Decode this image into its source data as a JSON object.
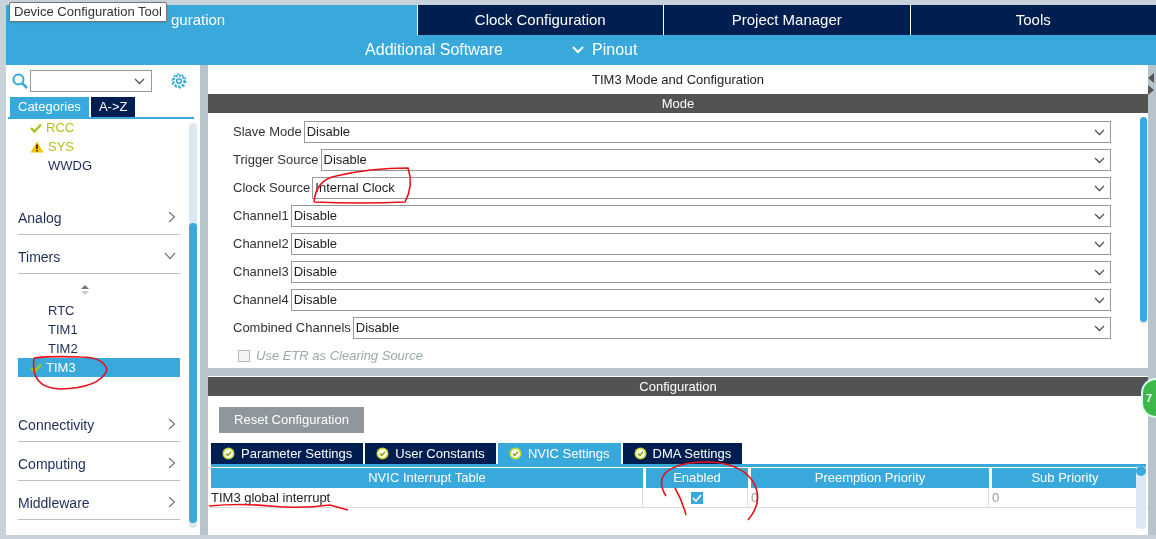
{
  "tooltip": {
    "text": "Device Configuration Tool"
  },
  "top_tabs": [
    {
      "label": "guration",
      "selected": true
    },
    {
      "label": "Clock Configuration",
      "selected": false
    },
    {
      "label": "Project Manager",
      "selected": false
    },
    {
      "label": "Tools",
      "selected": false
    }
  ],
  "sub_tabs": [
    {
      "label": "Additional Software",
      "kind": "link"
    },
    {
      "label": "Pinout",
      "kind": "dropdown"
    }
  ],
  "sidebar": {
    "view_tabs": [
      {
        "label": "Categories",
        "selected": true
      },
      {
        "label": "A->Z",
        "selected": false
      }
    ],
    "peripherals": [
      {
        "label": "RCC",
        "configured": true,
        "warning": false,
        "selected": false
      },
      {
        "label": "SYS",
        "configured": false,
        "warning": true,
        "selected": false
      },
      {
        "label": "WWDG",
        "configured": false,
        "warning": false,
        "selected": false
      }
    ],
    "categories": [
      {
        "label": "Analog",
        "expanded": false
      },
      {
        "label": "Timers",
        "expanded": true,
        "children": [
          {
            "label": "RTC",
            "configured": false,
            "warning": false,
            "selected": false
          },
          {
            "label": "TIM1",
            "configured": false,
            "warning": false,
            "selected": false
          },
          {
            "label": "TIM2",
            "configured": false,
            "warning": false,
            "selected": false
          },
          {
            "label": "TIM3",
            "configured": true,
            "warning": false,
            "selected": true
          }
        ]
      },
      {
        "label": "Connectivity",
        "expanded": false
      },
      {
        "label": "Computing",
        "expanded": false
      },
      {
        "label": "Middleware",
        "expanded": false
      }
    ]
  },
  "mode_panel": {
    "title": "TIM3 Mode and Configuration",
    "header": "Mode",
    "fields": [
      {
        "label": "Slave Mode",
        "value": "Disable"
      },
      {
        "label": "Trigger Source",
        "value": "Disable"
      },
      {
        "label": "Clock Source",
        "value": "Internal Clock"
      },
      {
        "label": "Channel1",
        "value": "Disable"
      },
      {
        "label": "Channel2",
        "value": "Disable"
      },
      {
        "label": "Channel3",
        "value": "Disable"
      },
      {
        "label": "Channel4",
        "value": "Disable"
      },
      {
        "label": "Combined Channels",
        "value": "Disable"
      }
    ],
    "option": {
      "label": "Use ETR as Clearing Source",
      "checked": false,
      "disabled": true
    }
  },
  "config_panel": {
    "header": "Configuration",
    "reset_button": "Reset Configuration",
    "tabs": [
      {
        "label": "Parameter Settings",
        "selected": false
      },
      {
        "label": "User Constants",
        "selected": false
      },
      {
        "label": "NVIC Settings",
        "selected": true
      },
      {
        "label": "DMA Settings",
        "selected": false
      }
    ],
    "table": {
      "columns": [
        "NVIC Interrupt Table",
        "Enabled",
        "Preemption Priority",
        "Sub Priority"
      ],
      "rows": [
        {
          "name": "TIM3 global interrupt",
          "enabled": true,
          "preemption_priority": "0",
          "sub_priority": "0"
        }
      ]
    }
  },
  "floating_badge": {
    "text": "7"
  }
}
